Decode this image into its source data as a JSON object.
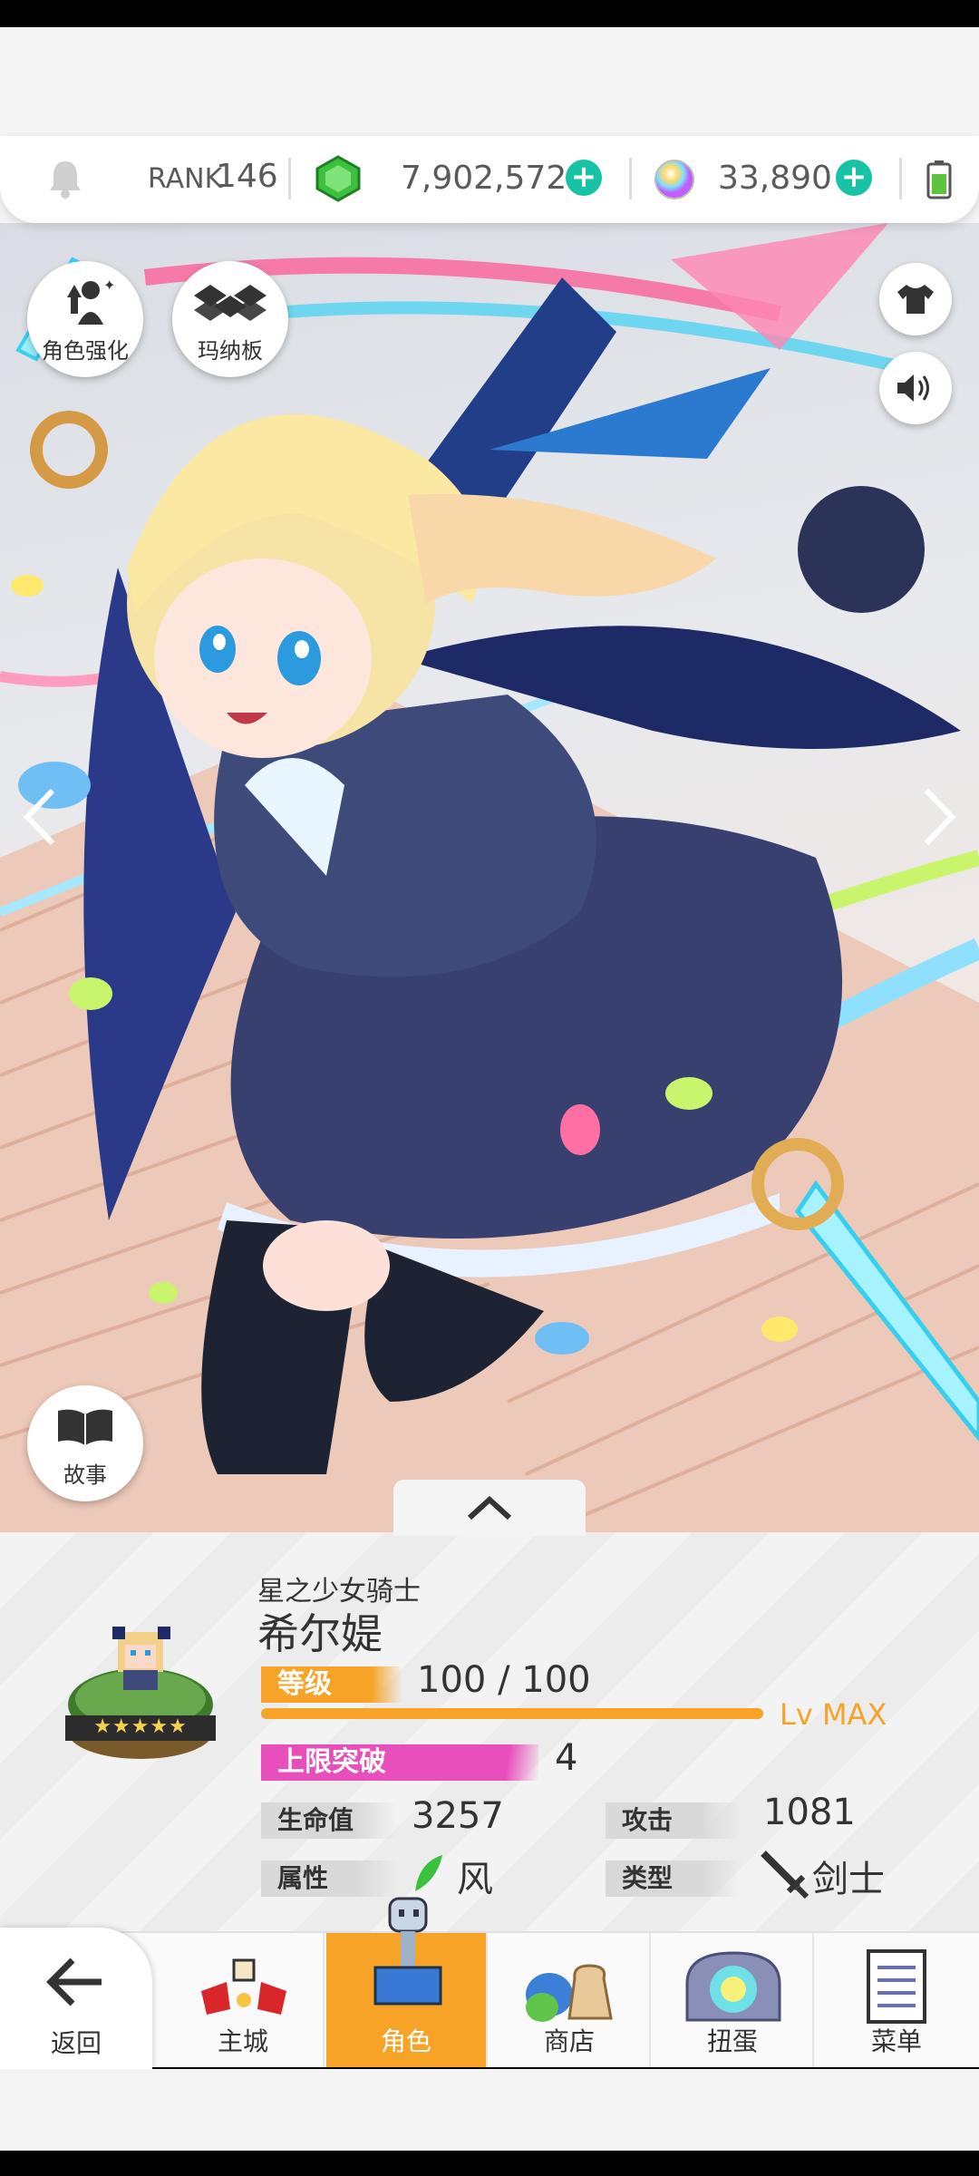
{
  "currency": {
    "rank_label": "RANK",
    "rank_value": "146",
    "gems": "7,902,572",
    "orbs": "33,890"
  },
  "art_buttons": {
    "enhance_label": "角色强化",
    "board_label": "玛纳板",
    "story_label": "故事"
  },
  "character": {
    "title": "星之少女骑士",
    "name": "希尔媞",
    "level_label": "等级",
    "level_value": "100 / 100",
    "level_fill": 1.0,
    "level_max": "Lv MAX",
    "limit_label": "上限突破",
    "limit_value": "4",
    "hp_label": "生命值",
    "hp_value": "3257",
    "atk_label": "攻击",
    "atk_value": "1081",
    "attr_label": "属性",
    "attr_value": "风",
    "type_label": "类型",
    "type_value": "剑士",
    "stars": "★★★★★"
  },
  "nav": {
    "back": "返回",
    "town": "主城",
    "character": "角色",
    "shop": "商店",
    "gacha": "扭蛋",
    "menu": "菜单"
  },
  "colors": {
    "accent_orange": "#f6a327",
    "limit_pink": "#e94fbb",
    "plus_teal": "#17c2a6",
    "gem_green": "#3cc13f"
  }
}
